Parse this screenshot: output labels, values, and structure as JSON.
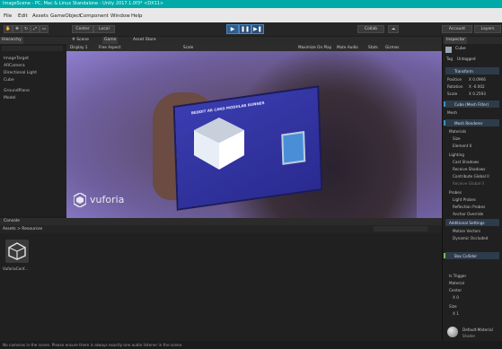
{
  "window": {
    "title": "ImageScene - PC, Mac & Linux Standalone - Unity 2017.1.0f3* <DX11>"
  },
  "menu": [
    "File",
    "Edit",
    "Assets",
    "GameObject",
    "Component",
    "Window",
    "Help"
  ],
  "toolbar": {
    "pivot": "Center",
    "local": "Local",
    "collab": "Collab",
    "account": "Account",
    "layers": "Layers"
  },
  "hierarchy": {
    "tab": "Hierarchy",
    "items": [
      "ImageTarget",
      "ARCamera",
      "Directional Light",
      "Cube",
      "GroundPlane",
      "Model"
    ]
  },
  "scene_tabs": {
    "scene": "# Scene",
    "game": "Game",
    "asset_store": "Asset Store"
  },
  "game_bar": {
    "display": "Display 1",
    "aspect": "Free Aspect",
    "scale": "Scale",
    "maximize": "Maximize On Play",
    "mute": "Mute Audio",
    "stats": "Stats",
    "gizmos": "Gizmos"
  },
  "viewport": {
    "brand": "vuforia",
    "card_heading": "BEDDIT AR CARD MODULAR RUNNER"
  },
  "project": {
    "tab": "Console",
    "breadcrumb": "Assets > Resources",
    "asset_name": "VuforiaConf..."
  },
  "inspector": {
    "tab": "Inspector",
    "object_name": "Cube",
    "tag_label": "Tag",
    "tag_value": "Untagged",
    "transform": "Transform",
    "position": "Position",
    "position_x": "X 0.0966",
    "rotation": "Rotation",
    "rotation_x": "X -0.002",
    "scale": "Scale",
    "scale_x": "X 0.2593",
    "mesh_filter": "Cube (Mesh Filter)",
    "mesh_label": "Mesh",
    "mesh_renderer": "Mesh Renderer",
    "materials": "Materials",
    "size": "Size",
    "element": "Element 0",
    "lighting": "Lighting",
    "cast_shadows": "Cast Shadows",
    "receive_shadows": "Receive Shadows",
    "contribute_gi": "Contribute Global Il",
    "receive_gi": "Receive Global Il",
    "probes": "Probes",
    "light_probes": "Light Probes",
    "reflection_probes": "Reflection Probes",
    "anchor_override": "Anchor Override",
    "additional": "Additional Settings",
    "motion_vectors": "Motion Vectors",
    "dynamic_occluded": "Dynamic Occluded",
    "box_collider": "Box Collider",
    "is_trigger": "Is Trigger",
    "material": "Material",
    "center": "Center",
    "center_x": "X 0",
    "size_field": "Size",
    "size_x": "X 1",
    "default_material": "Default-Material",
    "shader": "Shader"
  },
  "status": {
    "message": "No cameras in the scene. Please ensure there is always exactly one audio listener in the scene."
  },
  "colors": {
    "title": "#00aaa8",
    "accent_blue": "#2e5e8c",
    "viewport": "#6e5f9e"
  }
}
